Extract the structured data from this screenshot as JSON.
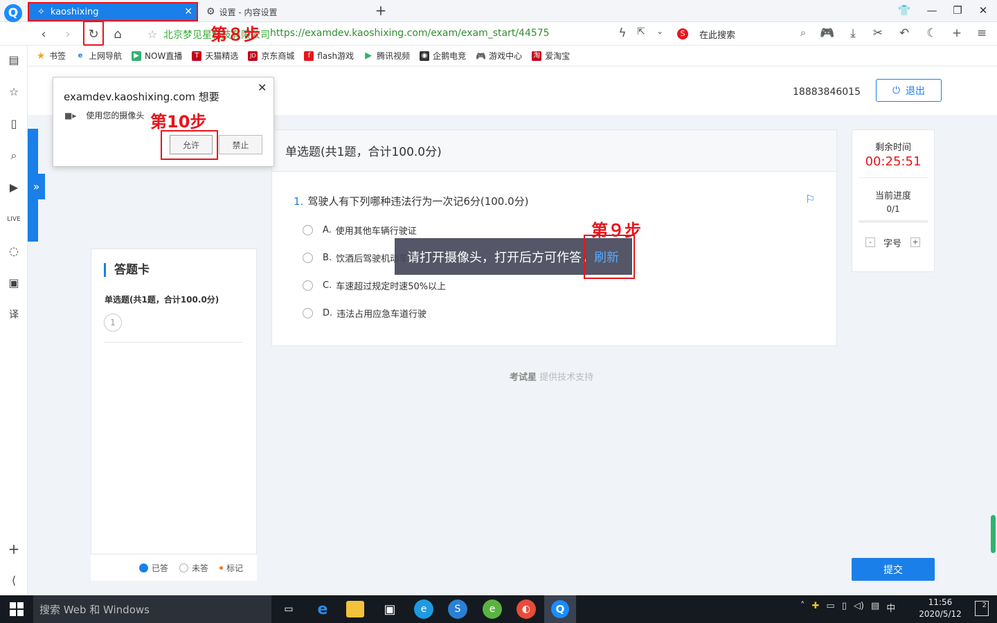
{
  "browser": {
    "tabs": [
      {
        "label": "kaoshixing",
        "active": true
      },
      {
        "label": "设置 - 内容设置",
        "active": false
      }
    ],
    "address_label": "北京梦见星科技有限公司",
    "url": "https://examdev.kaoshixing.com/exam/exam_start/44575",
    "search_placeholder": "在此搜索",
    "bookmarks": [
      "书签",
      "上网导航",
      "NOW直播",
      "天猫精选",
      "京东商城",
      "flash游戏",
      "腾讯视频",
      "企鹅电竞",
      "游戏中心",
      "爱淘宝"
    ]
  },
  "header": {
    "phone": "18883846015",
    "logout_label": "退出"
  },
  "question": {
    "section_title": "单选题(共1题，合计100.0分)",
    "number": "1.",
    "text": "驾驶人有下列哪种违法行为一次记6分(100.0分)",
    "options": [
      {
        "key": "A.",
        "text": "使用其他车辆行驶证"
      },
      {
        "key": "B.",
        "text": "饮酒后驾驶机动车"
      },
      {
        "key": "C.",
        "text": "车速超过规定时速50%以上"
      },
      {
        "key": "D.",
        "text": "违法占用应急车道行驶"
      }
    ]
  },
  "toast": {
    "message": "请打开摄像头，打开后方可作答，",
    "refresh": "刷新"
  },
  "footer": {
    "brand": "考试星",
    "text": "提供技术支持"
  },
  "timer": {
    "remaining_label": "剩余时间",
    "remaining": "00:25:51",
    "progress_label": "当前进度",
    "progress": "0/1",
    "progress_fraction": 0,
    "font_label": "字号",
    "minus": "-",
    "plus": "+"
  },
  "answer_card": {
    "title": "答题卡",
    "subtitle": "单选题(共1题，合计100.0分)",
    "items": [
      "1"
    ],
    "legend": {
      "answered": "已答",
      "unanswered": "未答",
      "marked": "标记"
    }
  },
  "submit_label": "提交",
  "permission": {
    "title": "examdev.kaoshixing.com 想要",
    "request": "使用您的摄像头",
    "allow": "允许",
    "deny": "禁止"
  },
  "steps": {
    "step8": "第８步",
    "step9": "第９步",
    "step10": "第10步"
  },
  "taskbar": {
    "search": "搜索 Web 和 Windows",
    "ime": "中",
    "time": "11:56",
    "date": "2020/5/12",
    "notifications": "2"
  },
  "colors": {
    "accent": "#1a7fe8",
    "highlight": "#e8141c",
    "timer": "#e8141c"
  }
}
